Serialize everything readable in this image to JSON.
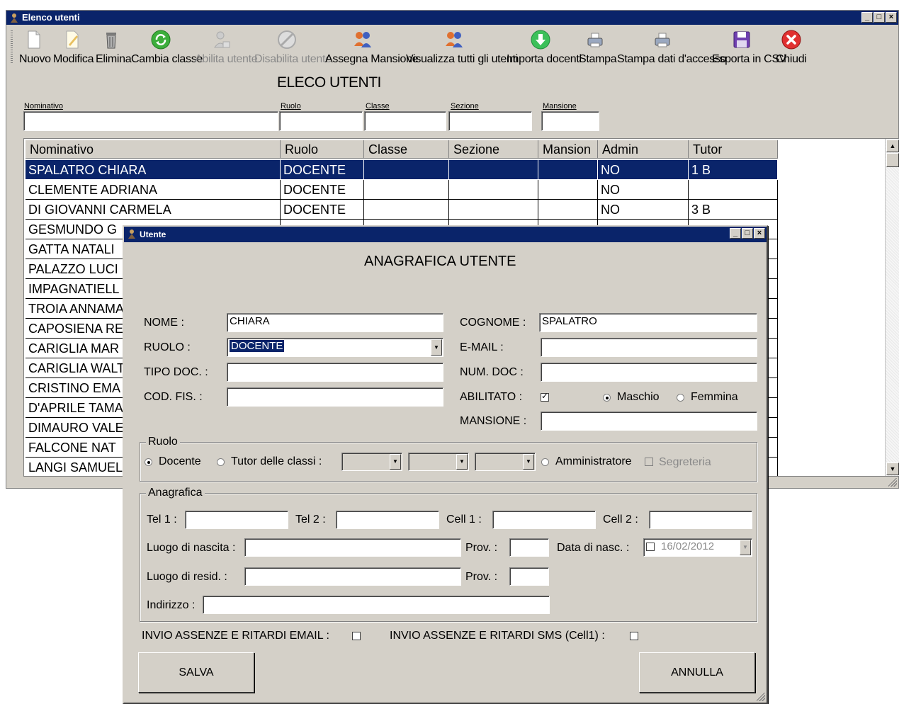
{
  "main": {
    "title": "Elenco utenti",
    "toolbar": {
      "nuovo": "Nuovo",
      "modifica": "Modifica",
      "elimina": "Elimina",
      "cambia_classe": "Cambia classe",
      "abilita_utente": "Abilita utente",
      "disabilita_utente": "Disabilita utente",
      "assegna_mansione": "Assegna Mansione",
      "visualizza_tutti": "Visualizza tutti gli utenti",
      "importa_docenti": "Importa docenti",
      "stampa": "Stampa",
      "stampa_dati": "Stampa dati d'accesso",
      "esporta_csv": "Esporta in CSV",
      "chiudi": "Chiudi"
    },
    "heading": "ELECO UTENTI",
    "filters": {
      "nominativo": "Nominativo",
      "ruolo": "Ruolo",
      "classe": "Classe",
      "sezione": "Sezione",
      "mansione": "Mansione"
    },
    "table": {
      "headers": [
        "Nominativo",
        "Ruolo",
        "Classe",
        "Sezione",
        "Mansion",
        "Admin",
        "Tutor"
      ],
      "rows": [
        [
          "SPALATRO CHIARA",
          "DOCENTE",
          "",
          "",
          "",
          "NO",
          "1 B"
        ],
        [
          "CLEMENTE ADRIANA",
          "DOCENTE",
          "",
          "",
          "",
          "NO",
          ""
        ],
        [
          "DI GIOVANNI CARMELA",
          "DOCENTE",
          "",
          "",
          "",
          "NO",
          "3 B"
        ],
        [
          "GESMUNDO G",
          "",
          "",
          "",
          "",
          "",
          ""
        ],
        [
          "GATTA NATALI",
          "",
          "",
          "",
          "",
          "",
          ""
        ],
        [
          "PALAZZO LUCI",
          "",
          "",
          "",
          "",
          "",
          ""
        ],
        [
          "IMPAGNATIELL",
          "",
          "",
          "",
          "",
          "",
          ""
        ],
        [
          "TROIA ANNAMA",
          "",
          "",
          "",
          "",
          "",
          ""
        ],
        [
          "CAPOSIENA RE",
          "",
          "",
          "",
          "",
          "",
          ""
        ],
        [
          "CARIGLIA MAR",
          "",
          "",
          "",
          "",
          "",
          ""
        ],
        [
          "CARIGLIA WALT",
          "",
          "",
          "",
          "",
          "",
          ""
        ],
        [
          "CRISTINO EMA",
          "",
          "",
          "",
          "",
          "",
          ""
        ],
        [
          "D'APRILE TAMA",
          "",
          "",
          "",
          "",
          "",
          ""
        ],
        [
          "DIMAURO VALE",
          "",
          "",
          "",
          "",
          "",
          ""
        ],
        [
          "FALCONE NAT",
          "",
          "",
          "",
          "",
          "",
          ""
        ],
        [
          "LANGI SAMUEL",
          "",
          "",
          "",
          "",
          "",
          ""
        ]
      ]
    }
  },
  "dialog": {
    "title": "Utente",
    "heading": "ANAGRAFICA UTENTE",
    "labels": {
      "nome": "NOME :",
      "ruolo": "RUOLO :",
      "tipo_doc": "TIPO DOC. :",
      "cod_fis": "COD. FIS. :",
      "cognome": "COGNOME :",
      "email": "E-MAIL :",
      "num_doc": "NUM. DOC :",
      "abilitato": "ABILITATO :",
      "maschio": "Maschio",
      "femmina": "Femmina",
      "mansione": "MANSIONE :"
    },
    "values": {
      "nome": "CHIARA",
      "ruolo": "DOCENTE",
      "cognome": "SPALATRO",
      "data_nasc": "16/02/2012"
    },
    "ruolo_group": {
      "title": "Ruolo",
      "docente": "Docente",
      "tutor": "Tutor delle classi :",
      "amministratore": "Amministratore",
      "segreteria": "Segreteria"
    },
    "anagrafica_group": {
      "title": "Anagrafica",
      "tel1": "Tel 1 :",
      "tel2": "Tel 2 :",
      "cell1": "Cell 1 :",
      "cell2": "Cell 2 :",
      "luogo_nascita": "Luogo di nascita :",
      "prov1": "Prov. :",
      "data_nasc": "Data di nasc. :",
      "luogo_resid": "Luogo di resid. :",
      "prov2": "Prov. :",
      "indirizzo": "Indirizzo :"
    },
    "invio_email": "INVIO ASSENZE E RITARDI  EMAIL :",
    "invio_sms": "INVIO ASSENZE E RITARDI  SMS (Cell1) :",
    "salva": "SALVA",
    "annulla": "ANNULLA"
  },
  "colors": {
    "titlebar": "#0a246a",
    "window_bg": "#d4d0c8",
    "selection": "#0a246a"
  }
}
